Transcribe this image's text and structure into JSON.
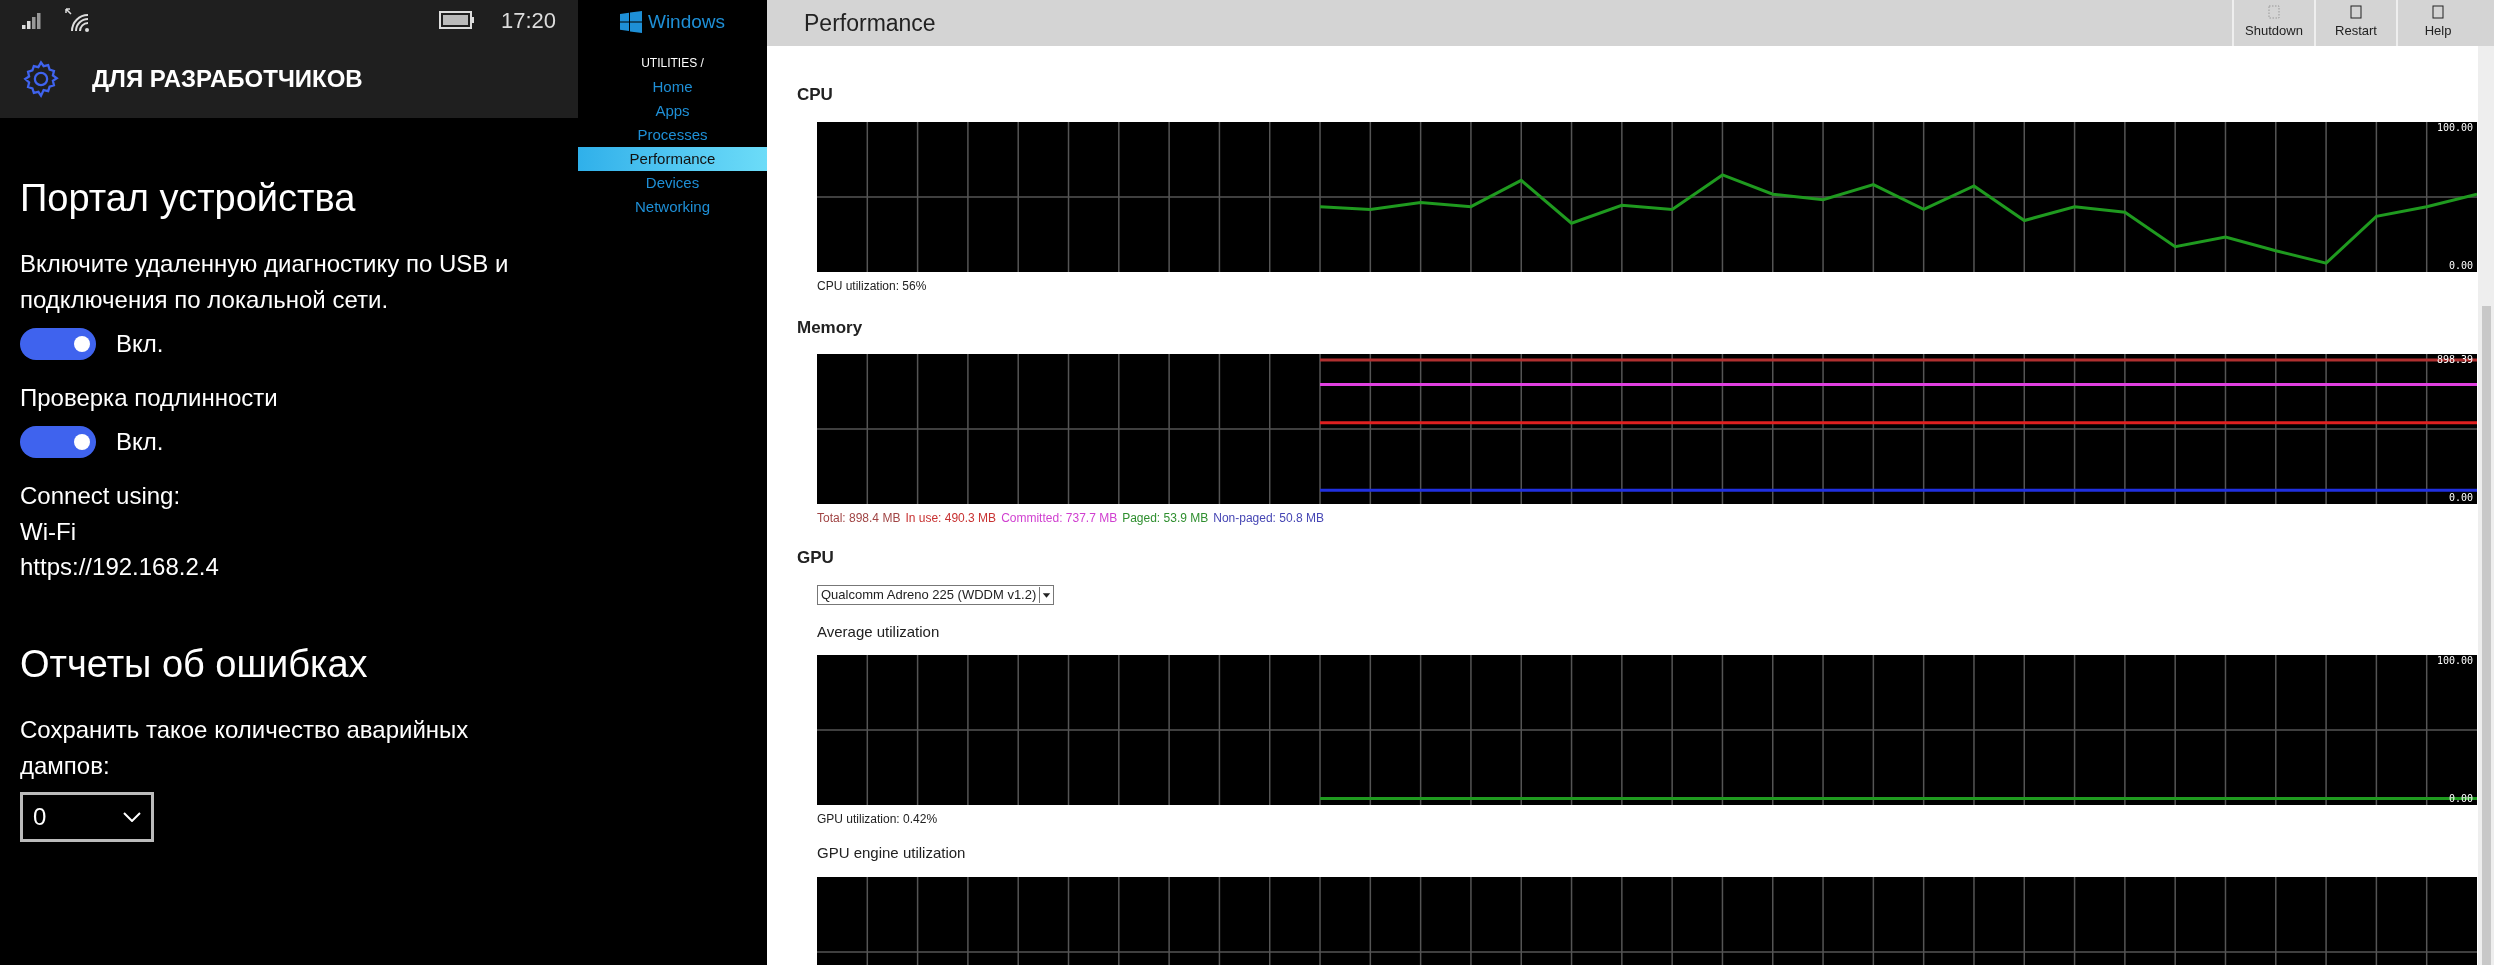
{
  "phone": {
    "status_bar": {
      "time": "17:20"
    },
    "header": {
      "title": "ДЛЯ РАЗРАБОТЧИКОВ"
    },
    "content": [
      {
        "kind": "heading",
        "text": "Портал устройства"
      },
      {
        "kind": "paragraph",
        "text": "Включите удаленную диагностику по USB и подключения по локальной сети."
      },
      {
        "kind": "toggle",
        "label": "Вкл.",
        "on": true
      },
      {
        "kind": "paragraph",
        "text": "Проверка подлинности"
      },
      {
        "kind": "toggle",
        "label": "Вкл.",
        "on": true
      },
      {
        "kind": "paragraph",
        "text": "Connect using:"
      },
      {
        "kind": "info",
        "text": "Wi-Fi"
      },
      {
        "kind": "info",
        "text": "https://192.168.2.4"
      },
      {
        "kind": "heading",
        "text": "Отчеты об ошибках"
      },
      {
        "kind": "paragraph",
        "text": "Сохранить такое количество аварийных дампов:"
      },
      {
        "kind": "dropdown",
        "value": "0"
      }
    ]
  },
  "sidebar": {
    "logo_text": "Windows",
    "breadcrumb": "UTILITIES /",
    "items": [
      {
        "label": "Home",
        "selected": false
      },
      {
        "label": "Apps",
        "selected": false
      },
      {
        "label": "Processes",
        "selected": false
      },
      {
        "label": "Performance",
        "selected": true
      },
      {
        "label": "Devices",
        "selected": false
      },
      {
        "label": "Networking",
        "selected": false
      }
    ]
  },
  "header": {
    "title": "Performance",
    "buttons": [
      {
        "label": "Shutdown",
        "kind": "dotted"
      },
      {
        "label": "Restart",
        "kind": "solid"
      },
      {
        "label": "Help",
        "kind": "solid"
      }
    ]
  },
  "cpu": {
    "title": "CPU",
    "caption": "CPU utilization: 56%",
    "chart_data": {
      "type": "line",
      "grid": true,
      "ylim": [
        -4.35,
        104.35
      ],
      "yticks": [
        {
          "value": 0,
          "label": "0.00"
        },
        {
          "value": 100,
          "label": "100.00"
        }
      ],
      "series": [
        {
          "color": "#1f9a1f",
          "values": [
            null,
            null,
            null,
            null,
            null,
            null,
            null,
            null,
            null,
            null,
            43,
            41,
            46,
            43,
            62,
            31,
            44,
            41,
            66,
            52,
            48,
            59,
            41,
            58,
            33,
            43,
            39,
            14,
            21,
            11,
            2,
            36,
            43,
            52
          ]
        }
      ]
    }
  },
  "memory": {
    "title": "Memory",
    "chart_data": {
      "type": "line",
      "grid": true,
      "ylim": [
        -39.06,
        937.45
      ],
      "yticks": [
        {
          "value": 0,
          "label": "0.00"
        },
        {
          "value": 898.39,
          "label": "898.39"
        }
      ],
      "series": [
        {
          "color": "#b03030",
          "values": [
            null,
            null,
            null,
            null,
            null,
            null,
            null,
            null,
            null,
            null,
            898,
            898,
            898,
            898,
            898,
            898,
            898,
            898,
            898,
            898,
            898,
            898,
            898,
            898,
            898,
            898,
            898,
            898,
            898,
            898,
            898,
            898,
            898,
            898
          ]
        },
        {
          "color": "#e02020",
          "values": [
            null,
            null,
            null,
            null,
            null,
            null,
            null,
            null,
            null,
            null,
            490,
            490,
            490,
            490,
            490,
            490,
            490,
            490,
            490,
            490,
            490,
            490,
            490,
            490,
            490,
            490,
            490,
            490,
            490,
            490,
            490,
            490,
            490,
            490
          ]
        },
        {
          "color": "#e040e0",
          "values": [
            null,
            null,
            null,
            null,
            null,
            null,
            null,
            null,
            null,
            null,
            738,
            738,
            738,
            738,
            738,
            738,
            738,
            738,
            738,
            738,
            738,
            738,
            738,
            738,
            738,
            738,
            738,
            738,
            738,
            738,
            738,
            738,
            738,
            738
          ]
        },
        {
          "color": "#2030e0",
          "values": [
            null,
            null,
            null,
            null,
            null,
            null,
            null,
            null,
            null,
            null,
            51,
            51,
            51,
            51,
            51,
            51,
            51,
            51,
            51,
            51,
            51,
            51,
            51,
            51,
            51,
            51,
            51,
            51,
            51,
            51,
            51,
            51,
            51,
            51
          ]
        }
      ]
    },
    "legend": [
      {
        "text": "Total: 898.4 MB",
        "color": "#a04444"
      },
      {
        "text": "In use: 490.3 MB",
        "color": "#c83232"
      },
      {
        "text": "Committed: 737.7 MB",
        "color": "#d03fd0"
      },
      {
        "text": "Paged: 53.9 MB",
        "color": "#2f8f2f"
      },
      {
        "text": "Non-paged: 50.8 MB",
        "color": "#4646b4"
      }
    ]
  },
  "gpu": {
    "title": "GPU",
    "adapter_select": {
      "value": "Qualcomm Adreno 225 (WDDM v1.2)"
    },
    "average": {
      "title": "Average utilization",
      "caption": "GPU utilization: 0.42%",
      "chart_data": {
        "type": "line",
        "grid": true,
        "ylim": [
          -4.35,
          104.35
        ],
        "yticks": [
          {
            "value": 0,
            "label": "0.00"
          },
          {
            "value": 100,
            "label": "100.00"
          }
        ],
        "series": [
          {
            "color": "#1f9a1f",
            "values": [
              null,
              null,
              null,
              null,
              null,
              null,
              null,
              null,
              null,
              null,
              0.4,
              0.4,
              0.4,
              0.4,
              0.4,
              0.4,
              0.4,
              0.4,
              0.4,
              0.4,
              0.4,
              0.4,
              0.4,
              0.4,
              0.4,
              0.4,
              0.4,
              0.4,
              0.4,
              0.4,
              0.4,
              0.4,
              0.4,
              0.4
            ]
          }
        ]
      }
    },
    "engine": {
      "title": "GPU engine utilization"
    }
  }
}
